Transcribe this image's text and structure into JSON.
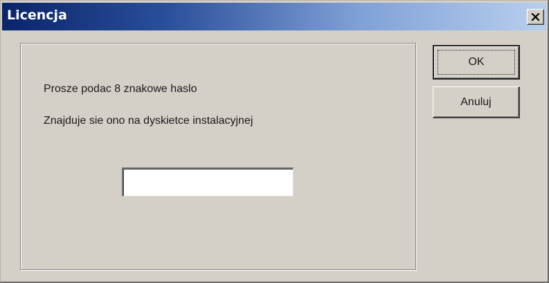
{
  "dialog": {
    "title": "Licencja",
    "close_glyph": "×"
  },
  "content": {
    "prompt_line_1": "Prosze podac 8 znakowe haslo",
    "prompt_line_2": "Znajduje sie ono na dyskietce instalacyjnej",
    "password_value": ""
  },
  "buttons": {
    "ok_label": "OK",
    "cancel_label": "Anuluj"
  },
  "icons": {
    "close": "close-icon"
  },
  "colors": {
    "titlebar_start": "#0a246a",
    "titlebar_end": "#b9cfee",
    "dialog_background": "#d4d0c8"
  }
}
